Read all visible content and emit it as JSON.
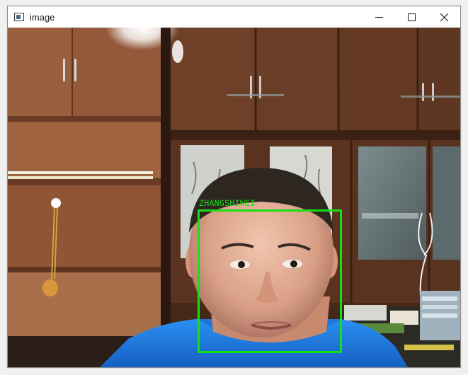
{
  "window": {
    "title": "image",
    "icon": "app-image-icon"
  },
  "controls": {
    "minimize": "minimize-icon",
    "maximize": "maximize-icon",
    "close": "close-icon"
  },
  "detection": {
    "label": "ZHANGSHIWEI",
    "box_color": "#14e014"
  }
}
